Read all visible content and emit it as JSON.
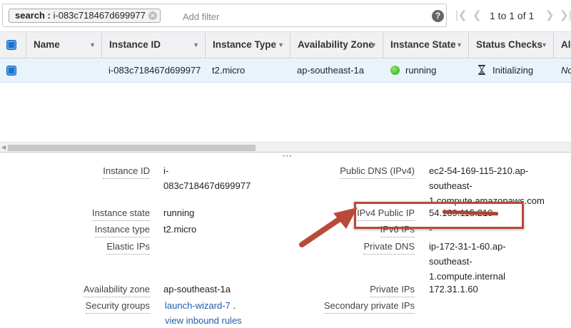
{
  "toolbar": {
    "search_token_key": "search :",
    "search_token_value": "i-083c718467d699977",
    "add_filter_placeholder": "Add filter",
    "help_icon": "?",
    "pager_label": "1 to 1 of 1",
    "icons": {
      "close": "token-close-icon",
      "help": "question-circle-icon",
      "first": "first-page-icon",
      "prev": "prev-page-icon",
      "next": "next-page-icon",
      "last": "last-page-icon"
    }
  },
  "table": {
    "columns": [
      {
        "label": "Name"
      },
      {
        "label": "Instance ID"
      },
      {
        "label": "Instance Type"
      },
      {
        "label": "Availability Zone"
      },
      {
        "label": "Instance State"
      },
      {
        "label": "Status Checks"
      },
      {
        "label": "Al"
      }
    ],
    "rows": [
      {
        "name": "",
        "instance_id": "i-083c718467d699977",
        "instance_type": "t2.micro",
        "availability_zone": "ap-southeast-1a",
        "instance_state": "running",
        "status_checks": "Initializing",
        "alarm": "No"
      }
    ]
  },
  "details": {
    "left": [
      {
        "label": "Instance ID",
        "value_lines": [
          "i-",
          "083c718467d699977"
        ]
      },
      {
        "label": "Instance state",
        "value_lines": [
          "running"
        ]
      },
      {
        "label": "Instance type",
        "value_lines": [
          "t2.micro"
        ]
      },
      {
        "label": "Elastic IPs",
        "value_lines": [
          ""
        ]
      },
      {
        "label": "Availability zone",
        "value_lines": [
          "ap-southeast-1a"
        ]
      },
      {
        "label": "Security groups",
        "links": [
          "launch-wizard-7",
          "view inbound rules"
        ],
        "suffix": "."
      }
    ],
    "right": [
      {
        "label": "Public DNS (IPv4)",
        "value_lines": [
          "ec2-54-169-115-210.ap-",
          "southeast-",
          "1.compute.amazonaws.com"
        ]
      },
      {
        "label": "IPv4 Public IP",
        "value_lines": [
          "54.169.115.210"
        ]
      },
      {
        "label": "IPv6 IPs",
        "value_lines": [
          "-"
        ]
      },
      {
        "label": "Private DNS",
        "value_lines": [
          "ip-172-31-1-60.ap-",
          "southeast-",
          "1.compute.internal"
        ]
      },
      {
        "label": "Private IPs",
        "value_lines": [
          "172.31.1.60"
        ]
      },
      {
        "label": "Secondary private IPs",
        "value_lines": [
          ""
        ]
      }
    ]
  },
  "colors": {
    "accent": "#1a73d1",
    "annotation": "#b94a38",
    "row_selected": "#e9f3fc",
    "link": "#1f5fa8"
  }
}
